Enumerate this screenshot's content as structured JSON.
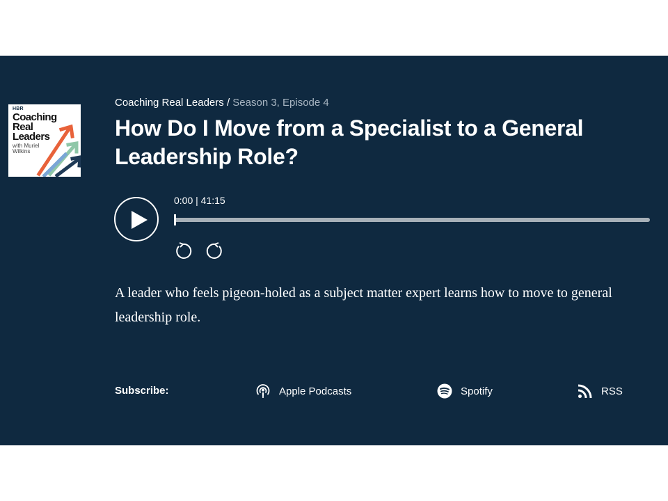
{
  "podcast": {
    "cover": {
      "brand": "HBR",
      "title_line1": "Coaching",
      "title_line2": "Real",
      "title_line3": "Leaders",
      "byline_line1": "with Muriel",
      "byline_line2": "Wilkins"
    },
    "series": "Coaching Real Leaders",
    "separator": " / ",
    "episode": "Season 3, Episode 4",
    "title": "How Do I Move from a Specialist to a General Leadership Role?",
    "description": "A leader who feels pigeon-holed as a subject matter expert learns how to move to general leadership role."
  },
  "player": {
    "time_display": "0:00 | 41:15",
    "progress": 0,
    "play_icon": "play-icon",
    "rewind_icon": "rewind-icon",
    "forward_icon": "forward-icon"
  },
  "subscribe": {
    "label": "Subscribe:",
    "links": [
      {
        "label": "Apple Podcasts",
        "icon": "podcast-icon"
      },
      {
        "label": "Spotify",
        "icon": "spotify-icon"
      },
      {
        "label": "RSS",
        "icon": "rss-icon"
      }
    ]
  },
  "colors": {
    "panel_bg": "#0f2940",
    "track": "#a7b0b8",
    "muted_text": "#a9b6c2",
    "cover_arrow_orange": "#e8623a",
    "cover_arrow_blue": "#1f3a56",
    "cover_arrow_lightblue": "#7aa6d6",
    "cover_arrow_green": "#8fc7a8"
  }
}
